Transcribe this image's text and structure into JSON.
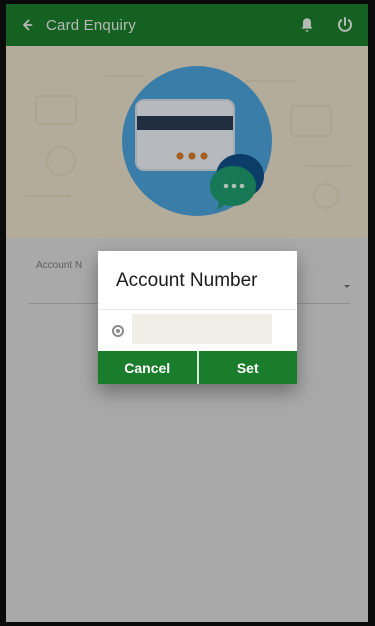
{
  "appbar": {
    "title": "Card Enquiry",
    "back_icon": "arrow-left-icon",
    "notification_icon": "bell-icon",
    "power_icon": "power-icon"
  },
  "form": {
    "account_label_visible": "Account N"
  },
  "dialog": {
    "title": "Account Number",
    "selected_option_value": "",
    "cancel_label": "Cancel",
    "set_label": "Set"
  },
  "colors": {
    "primary_green": "#1a7d2b",
    "hero_bg": "#e6ddc6",
    "hero_circle": "#4aa0d8",
    "overlay": "#000000"
  }
}
